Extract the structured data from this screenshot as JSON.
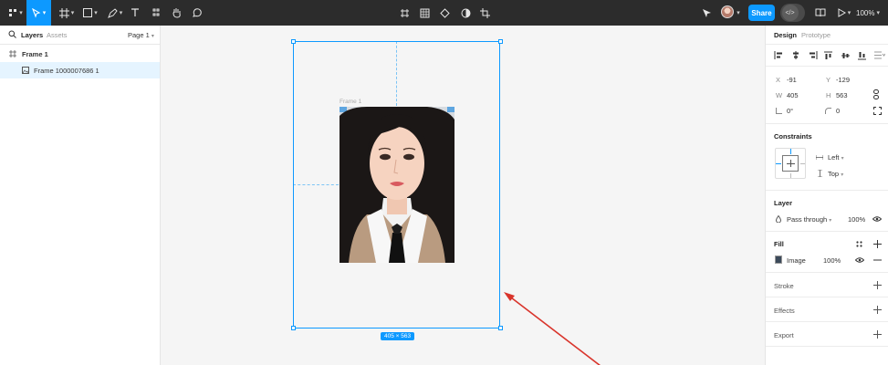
{
  "toolbar": {
    "share_label": "Share",
    "zoom_label": "100%"
  },
  "left_panel": {
    "tabs": {
      "layers": "Layers",
      "assets": "Assets",
      "page": "Page 1"
    },
    "layers": [
      {
        "name": "Frame 1"
      },
      {
        "name": "Frame 1000007686 1"
      }
    ]
  },
  "canvas": {
    "frame_label": "Frame 1",
    "size_badge": "405 × 563"
  },
  "right_panel": {
    "tabs": {
      "design": "Design",
      "prototype": "Prototype"
    },
    "position": {
      "x_label": "X",
      "x_value": "-91",
      "y_label": "Y",
      "y_value": "-129"
    },
    "size": {
      "w_label": "W",
      "w_value": "405",
      "h_label": "H",
      "h_value": "563"
    },
    "rotation": "0°",
    "radius": "0",
    "constraints": {
      "title": "Constraints",
      "horizontal": "Left",
      "vertical": "Top"
    },
    "layer": {
      "title": "Layer",
      "blend": "Pass through",
      "opacity": "100%"
    },
    "fill": {
      "title": "Fill",
      "type": "Image",
      "opacity": "100%"
    },
    "stroke": {
      "title": "Stroke"
    },
    "effects": {
      "title": "Effects"
    },
    "export": {
      "title": "Export"
    }
  },
  "colors": {
    "accent": "#0d99ff",
    "toolbar_bg": "#2c2c2c",
    "annotation_arrow": "#d9342b"
  }
}
